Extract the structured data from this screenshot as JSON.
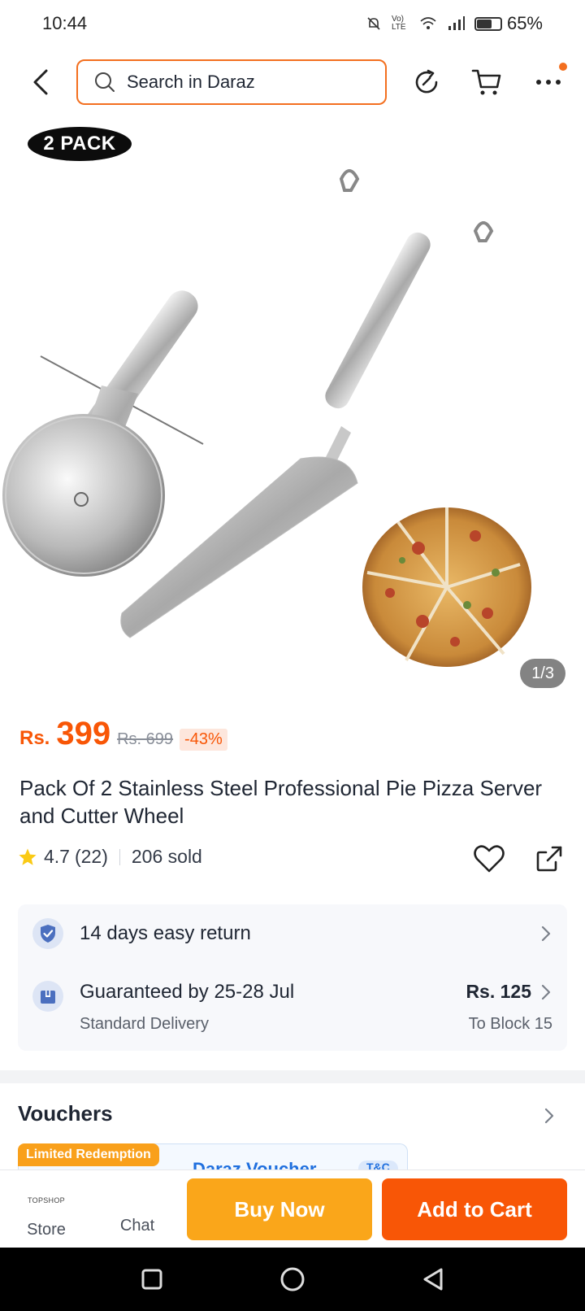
{
  "status_bar": {
    "time": "10:44",
    "network": "Vo) LTE",
    "battery_pct": "65%"
  },
  "header": {
    "search_placeholder": "Search in Daraz",
    "accent_color": "#f36f1f"
  },
  "gallery": {
    "badge": "2 PACK",
    "counter": "1/3"
  },
  "product": {
    "currency": "Rs.",
    "price": "399",
    "old_price": "Rs. 699",
    "discount": "-43%",
    "title": "Pack Of 2 Stainless Steel Professional Pie Pizza Server and Cutter Wheel",
    "rating": "4.7",
    "reviews": "(22)",
    "sold": "206 sold"
  },
  "service": {
    "return_text": "14 days easy return",
    "delivery_text": "Guaranteed by 25-28 Jul",
    "delivery_type": "Standard Delivery",
    "delivery_fee": "Rs. 125",
    "delivery_location": "To Block 15"
  },
  "vouchers": {
    "title": "Vouchers",
    "limited_tag": "Limited Redemption",
    "voucher_name": "Daraz Voucher",
    "tnc": "T&C"
  },
  "bottom_bar": {
    "store_logo": "TOPSHOP",
    "store_label": "Store",
    "chat_label": "Chat",
    "buy_now": "Buy Now",
    "add_to_cart": "Add to Cart",
    "buy_color": "#faa61a",
    "cart_color": "#f85606"
  }
}
